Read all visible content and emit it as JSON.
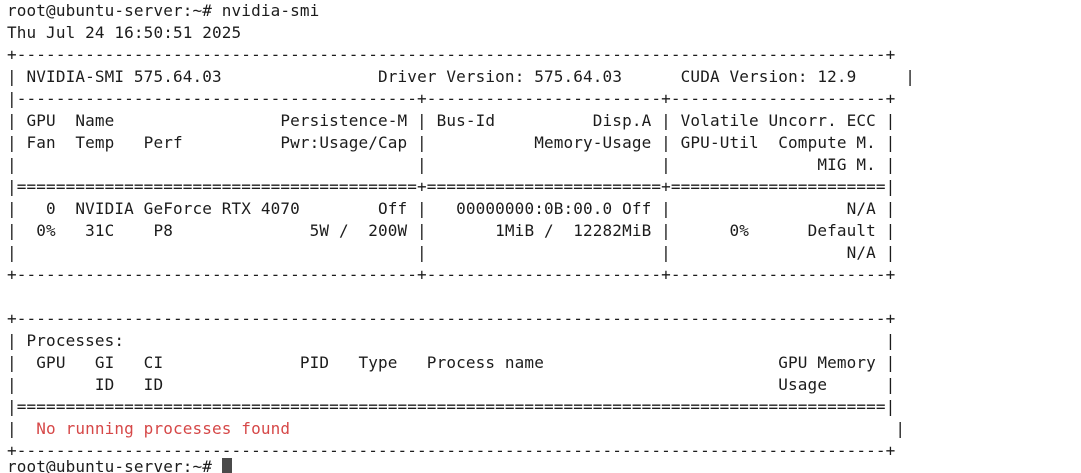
{
  "terminal": {
    "prompt_cmd": "root@ubuntu-server:~# nvidia-smi",
    "timestamp": "Thu Jul 24 16:50:51 2025",
    "smi_version": "NVIDIA-SMI 575.64.03",
    "driver_version_label": "Driver Version: 575.64.03",
    "cuda_version_label": "CUDA Version: 12.9",
    "gpu_header": {
      "l1c1": " GPU  Name                 Persistence-M",
      "l1c2": " Bus-Id          Disp.A",
      "l1c3": " Volatile Uncorr. ECC",
      "l2c1": " Fan  Temp   Perf          Pwr:Usage/Cap",
      "l2c2": "           Memory-Usage",
      "l2c3": " GPU-Util  Compute M.",
      "l3c1": "                                        ",
      "l3c2": "                       ",
      "l3c3": "               MIG M."
    },
    "gpu_row": {
      "l1c1": "   0  NVIDIA GeForce RTX 4070        Off",
      "l1c2": "   00000000:0B:00.0 Off",
      "l1c3": "                  N/A",
      "l2c1": "  0%   31C    P8              5W /  200W",
      "l2c2": "       1MiB /  12282MiB",
      "l2c3": "      0%      Default",
      "l3c1": "                                        ",
      "l3c2": "                       ",
      "l3c3": "                  N/A"
    },
    "processes": {
      "title": "Processes:",
      "header1": "  GPU   GI   CI              PID   Type   Process name                        GPU Memory",
      "header2": "        ID   ID                                                               Usage     ",
      "empty_message": "  No running processes found"
    },
    "final_prompt": "root@ubuntu-server:~# "
  },
  "colors": {
    "background": "#ffffff",
    "text": "#1c1c1c",
    "error_text": "#d64848"
  }
}
